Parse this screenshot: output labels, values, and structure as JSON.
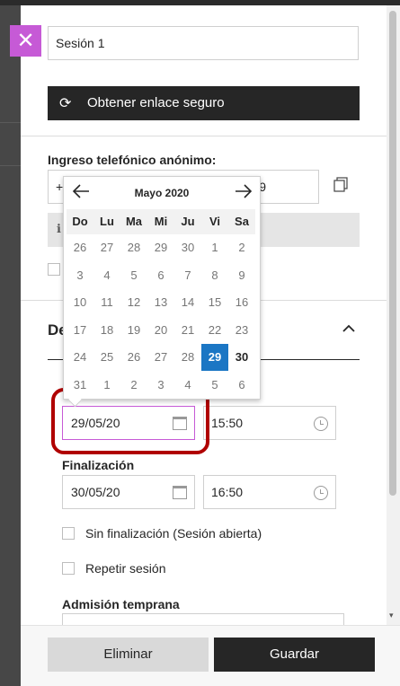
{
  "session": {
    "name_value": "Sesión 1",
    "secure_link_label": "Obtener enlace seguro"
  },
  "phone": {
    "heading": "Ingreso telefónico anónimo:",
    "input_start": "+",
    "input_end": "9"
  },
  "details": {
    "label_partial": "De"
  },
  "start": {
    "date_value": "29/05/20",
    "time_value": "15:50"
  },
  "end": {
    "label": "Finalización",
    "date_value": "30/05/20",
    "time_value": "16:50"
  },
  "options": {
    "no_end_label": "Sin finalización (Sesión abierta)",
    "repeat_label": "Repetir sesión",
    "early_label": "Admisión temprana"
  },
  "footer": {
    "delete_label": "Eliminar",
    "save_label": "Guardar"
  },
  "calendar": {
    "title": "Mayo 2020",
    "weekdays": [
      "Do",
      "Lu",
      "Ma",
      "Mi",
      "Ju",
      "Vi",
      "Sa"
    ],
    "weeks": [
      [
        "26",
        "27",
        "28",
        "29",
        "30",
        "1",
        "2"
      ],
      [
        "3",
        "4",
        "5",
        "6",
        "7",
        "8",
        "9"
      ],
      [
        "10",
        "11",
        "12",
        "13",
        "14",
        "15",
        "16"
      ],
      [
        "17",
        "18",
        "19",
        "20",
        "21",
        "22",
        "23"
      ],
      [
        "24",
        "25",
        "26",
        "27",
        "28",
        "29",
        "30"
      ],
      [
        "31",
        "1",
        "2",
        "3",
        "4",
        "5",
        "6"
      ]
    ],
    "selected_day": "29",
    "selected_week": 4
  },
  "colors": {
    "accent": "#c65ad6",
    "highlight_red": "#b00000",
    "selected_blue": "#1b76c4",
    "dark_button": "#262626"
  }
}
